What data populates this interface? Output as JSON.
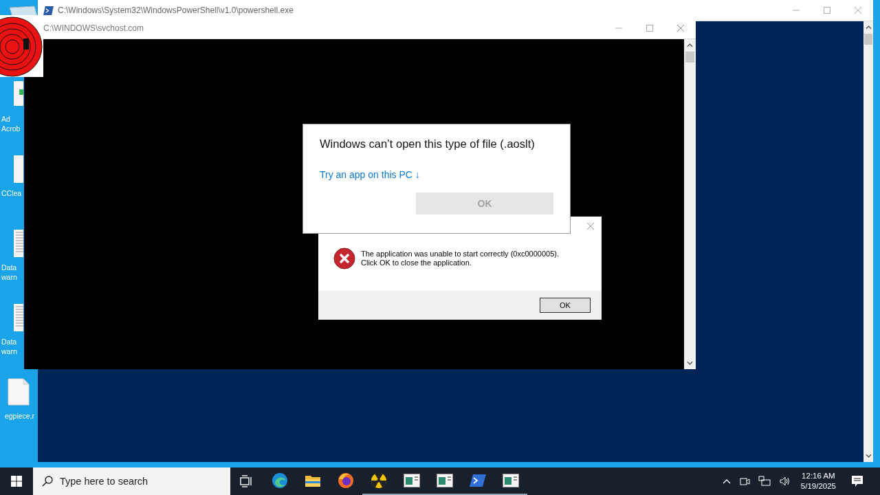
{
  "desktop_icons": [
    {
      "kind": "pdf",
      "label": "Ad\nAcrob"
    },
    {
      "kind": "blank",
      "label": "CClea"
    },
    {
      "kind": "lined",
      "label": "Data\nwarn"
    },
    {
      "kind": "lined",
      "label": "Data\nwarn"
    },
    {
      "kind": "file",
      "label": "egpiece.r"
    }
  ],
  "powershell_window": {
    "title": "C:\\Windows\\System32\\WindowsPowerShell\\v1.0\\powershell.exe"
  },
  "console_window": {
    "title": "C:\\WINDOWS\\svchost.com"
  },
  "open_with_dialog": {
    "title": "Windows can’t open this type of file (.aoslt)",
    "link": "Try an app on this PC",
    "link_arrow": "↓",
    "ok_button": {
      "label": "OK",
      "disabled": true
    }
  },
  "error_dialog": {
    "message_lines": [
      "The application was unable to start correctly (0xc0000005).",
      "Click OK to close the application."
    ],
    "ok_button": {
      "label": "OK",
      "disabled": false
    }
  },
  "taskbar": {
    "search": {
      "placeholder": "Type here to search"
    },
    "apps": [
      {
        "kind": "edge",
        "running": false
      },
      {
        "kind": "folder",
        "running": false
      },
      {
        "kind": "firefox",
        "running": false
      },
      {
        "kind": "radiation",
        "running": true
      },
      {
        "kind": "window",
        "running": true
      },
      {
        "kind": "window",
        "running": true
      },
      {
        "kind": "powershell",
        "running": true
      },
      {
        "kind": "window",
        "running": true
      }
    ],
    "clock": {
      "time": "12:16 AM",
      "date": "5/19/2025"
    }
  }
}
